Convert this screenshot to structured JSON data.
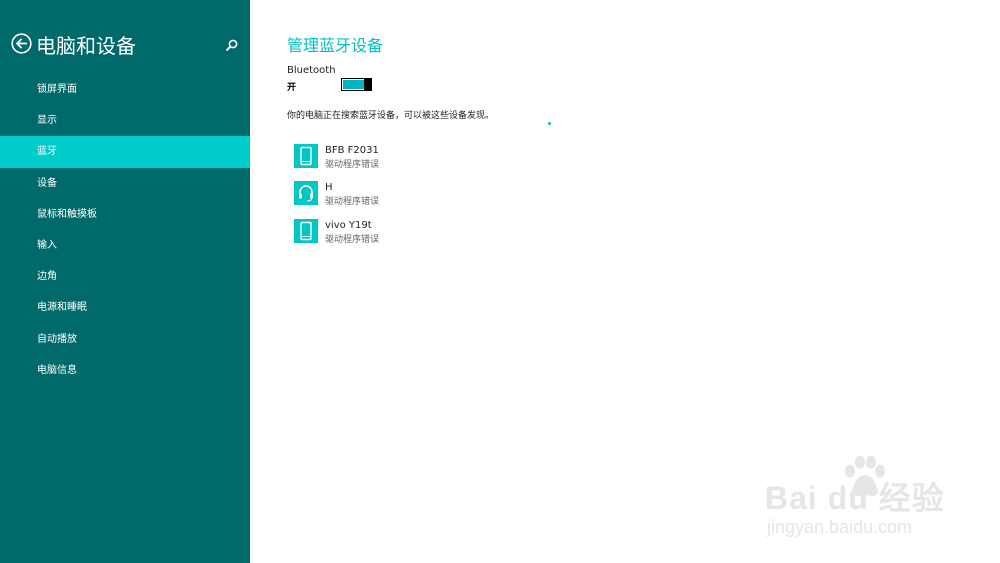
{
  "sidebar": {
    "title": "电脑和设备",
    "back_icon": "back-arrow-icon",
    "search_icon": "search-icon",
    "items": [
      {
        "label": "锁屏界面",
        "selected": false
      },
      {
        "label": "显示",
        "selected": false
      },
      {
        "label": "蓝牙",
        "selected": true
      },
      {
        "label": "设备",
        "selected": false
      },
      {
        "label": "鼠标和触摸板",
        "selected": false
      },
      {
        "label": "输入",
        "selected": false
      },
      {
        "label": "边角",
        "selected": false
      },
      {
        "label": "电源和睡眠",
        "selected": false
      },
      {
        "label": "自动播放",
        "selected": false
      },
      {
        "label": "电脑信息",
        "selected": false
      }
    ]
  },
  "main": {
    "title": "管理蓝牙设备",
    "bluetooth_label": "Bluetooth",
    "bluetooth_state": "开",
    "bluetooth_on": true,
    "searching_text": "你的电脑正在搜索蓝牙设备，可以被这些设备发现。",
    "devices": [
      {
        "name": "BFB F2031",
        "status": "驱动程序错误",
        "icon": "phone-icon"
      },
      {
        "name": "H",
        "status": "驱动程序错误",
        "icon": "headset-icon"
      },
      {
        "name": "vivo Y19t",
        "status": "驱动程序错误",
        "icon": "phone-icon"
      }
    ]
  },
  "watermark": {
    "brand": "Bai du 经验",
    "url": "jingyan.baidu.com"
  },
  "colors": {
    "sidebar_bg": "#006969",
    "selected_bg": "#00cccc",
    "accent": "#00c2c2",
    "tile_bg": "#00c6c6"
  }
}
